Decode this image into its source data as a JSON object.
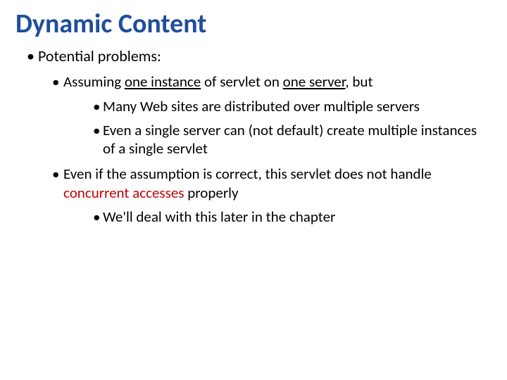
{
  "title": "Dynamic Content",
  "l1": "Potential problems:",
  "l2a_pre": "Assuming ",
  "l2a_u1": "one instance",
  "l2a_mid": " of servlet on ",
  "l2a_u2": "one server",
  "l2a_post": ", but",
  "l3a": "Many Web sites are distributed over multiple servers",
  "l3b": "Even a single server can (not default) create multiple instances of a single servlet",
  "l2b_pre": "Even if the assumption is correct, this servlet does not handle ",
  "l2b_red": "concurrent accesses",
  "l2b_post": " properly",
  "l3c": "We'll deal with this later in the chapter"
}
